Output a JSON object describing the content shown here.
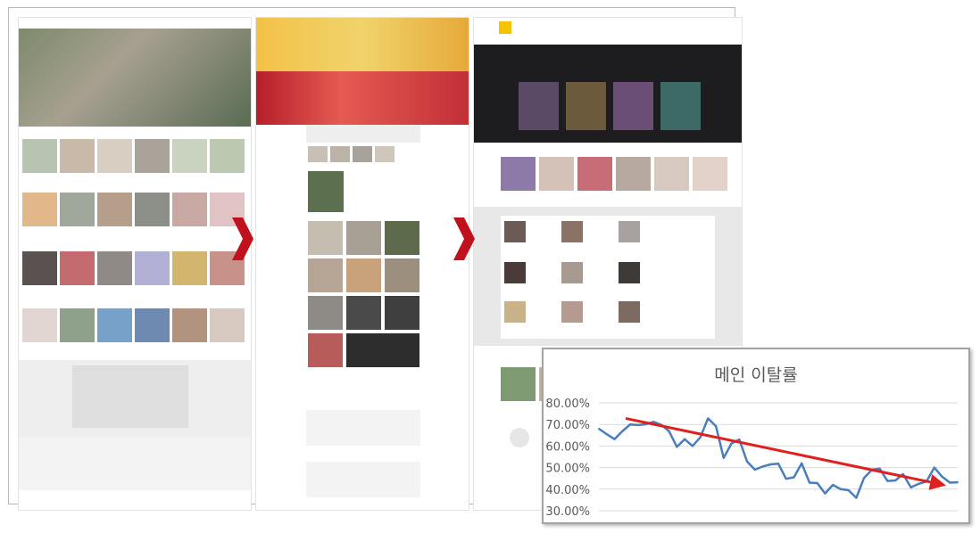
{
  "colors": {
    "line": "#4a7ebb",
    "trend": "#e02020",
    "grid": "#d9d9d9",
    "axis_text": "#595959",
    "flow_arrow": "#c0121c"
  },
  "panels": [
    {
      "name": "page-v1"
    },
    {
      "name": "page-v2"
    },
    {
      "name": "page-v3"
    }
  ],
  "chart_data": {
    "type": "line",
    "title": "메인 이탈률",
    "xlabel": "",
    "ylabel": "",
    "ylim": [
      0.3,
      0.8
    ],
    "yticks": [
      "80.00%",
      "70.00%",
      "60.00%",
      "50.00%",
      "40.00%",
      "30.00%"
    ],
    "grid": true,
    "legend": "none",
    "series": [
      {
        "values": [
          0.68,
          0.655,
          0.632,
          0.668,
          0.7,
          0.697,
          0.701,
          0.712,
          0.698,
          0.668,
          0.596,
          0.632,
          0.6,
          0.64,
          0.728,
          0.692,
          0.545,
          0.612,
          0.63,
          0.528,
          0.49,
          0.505,
          0.515,
          0.518,
          0.448,
          0.455,
          0.52,
          0.43,
          0.428,
          0.38,
          0.42,
          0.4,
          0.395,
          0.36,
          0.452,
          0.49,
          0.495,
          0.438,
          0.44,
          0.47,
          0.408,
          0.425,
          0.435,
          0.5,
          0.458,
          0.43,
          0.432
        ]
      }
    ],
    "trendline": {
      "start": 0.728,
      "end": 0.42
    }
  }
}
